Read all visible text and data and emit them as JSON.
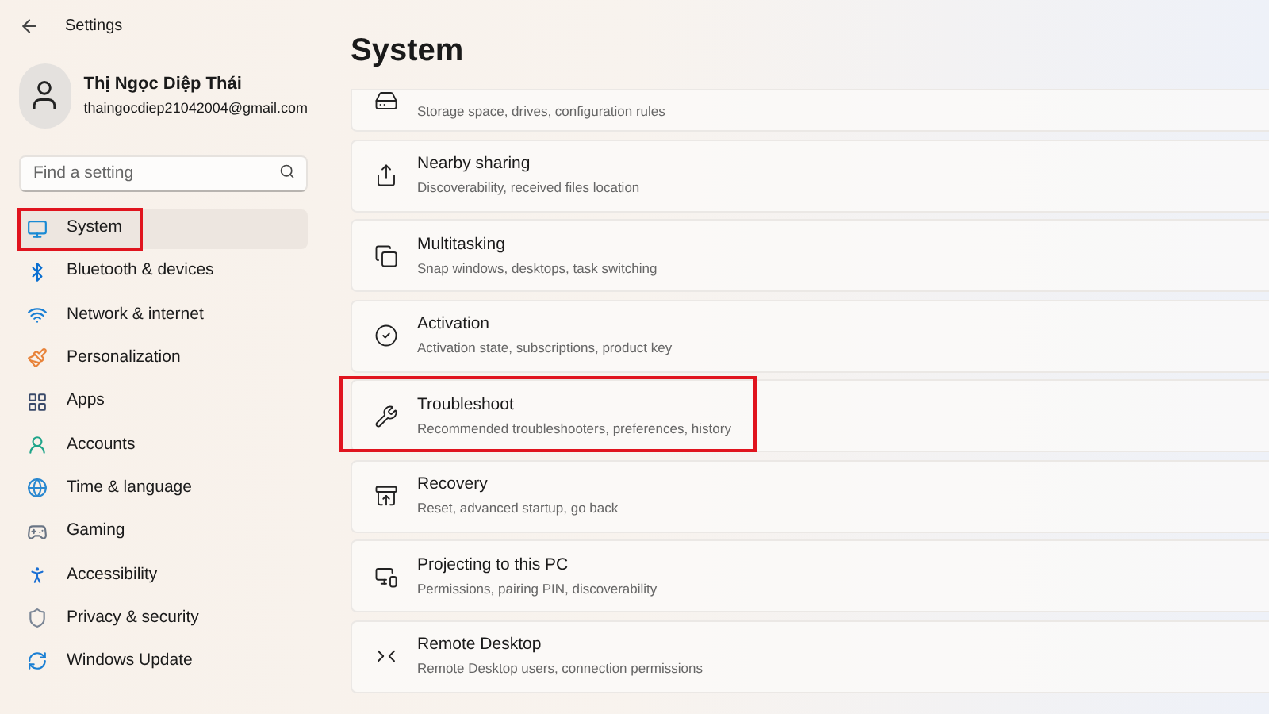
{
  "window": {
    "title": "Settings"
  },
  "user": {
    "name": "Thị Ngọc Diệp Thái",
    "email": "thaingocdiep21042004@gmail.com"
  },
  "search": {
    "placeholder": "Find a setting"
  },
  "sidebar": {
    "items": [
      {
        "kind": "system",
        "label": "System",
        "selected": true,
        "highlighted": true
      },
      {
        "kind": "bluetooth",
        "label": "Bluetooth & devices",
        "selected": false,
        "highlighted": false
      },
      {
        "kind": "network",
        "label": "Network & internet",
        "selected": false,
        "highlighted": false
      },
      {
        "kind": "personalization",
        "label": "Personalization",
        "selected": false,
        "highlighted": false
      },
      {
        "kind": "apps",
        "label": "Apps",
        "selected": false,
        "highlighted": false
      },
      {
        "kind": "accounts",
        "label": "Accounts",
        "selected": false,
        "highlighted": false
      },
      {
        "kind": "time",
        "label": "Time & language",
        "selected": false,
        "highlighted": false
      },
      {
        "kind": "gaming",
        "label": "Gaming",
        "selected": false,
        "highlighted": false
      },
      {
        "kind": "accessibility",
        "label": "Accessibility",
        "selected": false,
        "highlighted": false
      },
      {
        "kind": "privacy",
        "label": "Privacy & security",
        "selected": false,
        "highlighted": false
      },
      {
        "kind": "update",
        "label": "Windows Update",
        "selected": false,
        "highlighted": false
      }
    ]
  },
  "page": {
    "title": "System",
    "cards": [
      {
        "kind": "storage",
        "description": "Storage space, drives, configuration rules",
        "highlighted": false
      },
      {
        "kind": "sharing",
        "title": "Nearby sharing",
        "description": "Discoverability, received files location",
        "highlighted": false
      },
      {
        "kind": "multitasking",
        "title": "Multitasking",
        "description": "Snap windows, desktops, task switching",
        "highlighted": false
      },
      {
        "kind": "activation",
        "title": "Activation",
        "description": "Activation state, subscriptions, product key",
        "highlighted": false
      },
      {
        "kind": "troubleshoot",
        "title": "Troubleshoot",
        "description": "Recommended troubleshooters, preferences, history",
        "highlighted": true
      },
      {
        "kind": "recovery",
        "title": "Recovery",
        "description": "Reset, advanced startup, go back",
        "highlighted": false
      },
      {
        "kind": "projecting",
        "title": "Projecting to this PC",
        "description": "Permissions, pairing PIN, discoverability",
        "highlighted": false
      },
      {
        "kind": "remote",
        "title": "Remote Desktop",
        "description": "Remote Desktop users, connection permissions",
        "highlighted": false
      }
    ]
  }
}
